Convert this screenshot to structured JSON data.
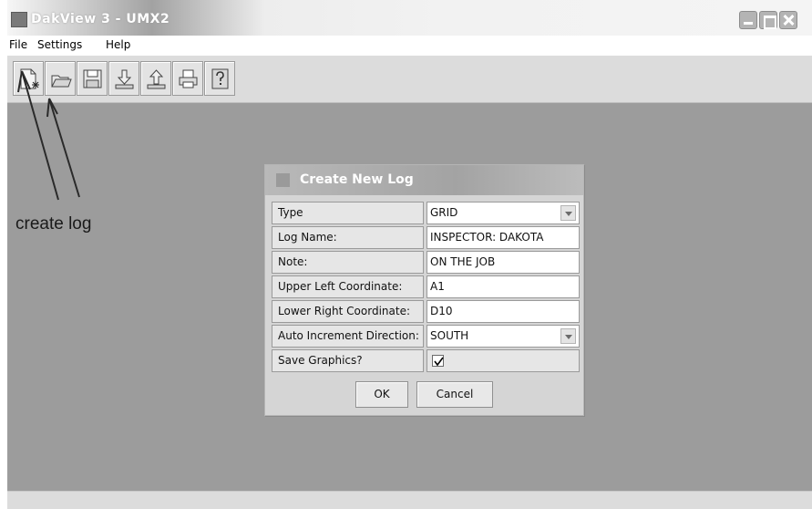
{
  "window": {
    "title": "DakView 3 - UMX2"
  },
  "menu": {
    "items": [
      "File",
      "Settings",
      "Help"
    ]
  },
  "toolbar": {
    "icons": [
      "new-log-icon",
      "open-folder-icon",
      "save-icon",
      "download-icon",
      "upload-icon",
      "print-icon",
      "help-icon"
    ]
  },
  "annotation": {
    "text": "create log"
  },
  "dialog": {
    "title": "Create New Log",
    "fields": [
      {
        "label": "Type",
        "value": "GRID",
        "control": "dropdown"
      },
      {
        "label": "Log Name:",
        "value": "INSPECTOR:  DAKOTA",
        "control": "text"
      },
      {
        "label": "Note:",
        "value": "ON THE JOB",
        "control": "text"
      },
      {
        "label": "Upper Left Coordinate:",
        "value": "A1",
        "control": "text"
      },
      {
        "label": "Lower Right Coordinate:",
        "value": "D10",
        "control": "text"
      },
      {
        "label": "Auto Increment Direction:",
        "value": "SOUTH",
        "control": "dropdown"
      },
      {
        "label": "Save Graphics?",
        "value": "",
        "control": "checkbox",
        "checked": true
      }
    ],
    "ok_label": "OK",
    "cancel_label": "Cancel"
  }
}
